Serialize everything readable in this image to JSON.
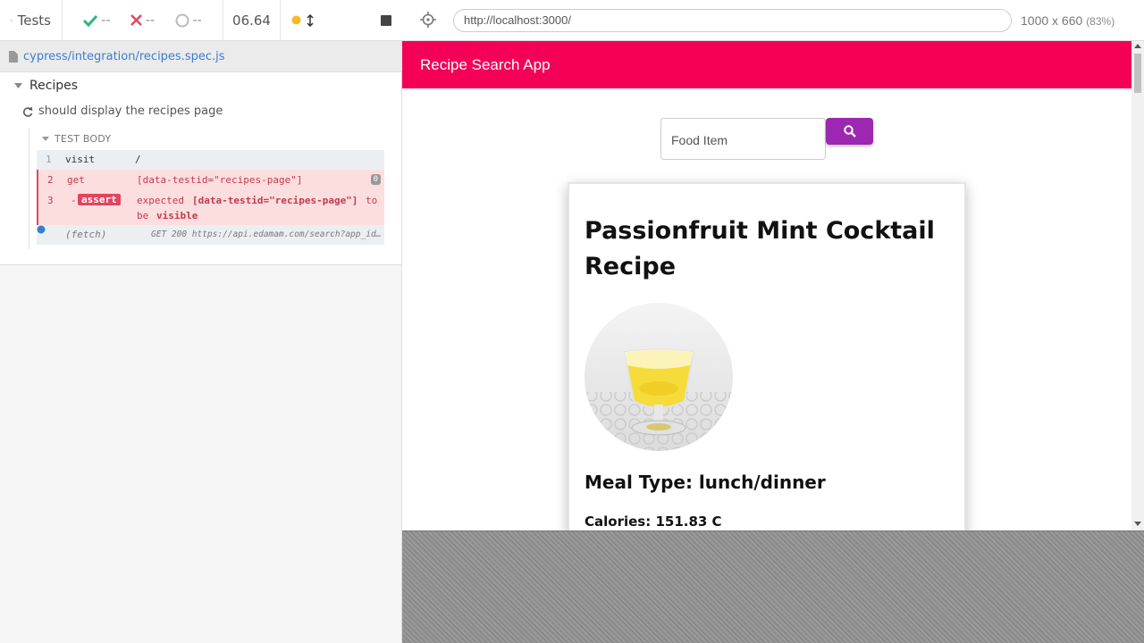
{
  "runner": {
    "tests_label": "Tests",
    "passed": "--",
    "failed": "--",
    "pending": "--",
    "duration": "06.64"
  },
  "spec": {
    "path": "cypress/integration/recipes.spec.js"
  },
  "reporter": {
    "suite": "Recipes",
    "test": "should display the recipes page",
    "body_label": "TEST BODY",
    "commands": [
      {
        "num": "1",
        "name": "visit",
        "message": "/"
      },
      {
        "num": "2",
        "name": "get",
        "message": "[data-testid=\"recipes-page\"]",
        "count": "0"
      },
      {
        "num": "3",
        "prefix": "-",
        "name": "assert",
        "message_parts": [
          "expected",
          "[data-testid=\"recipes-page\"]",
          "to",
          "be",
          "visible"
        ]
      },
      {
        "name": "(fetch)",
        "message": "GET 200 https://api.edamam.com/search?app_id…"
      }
    ]
  },
  "browser": {
    "url": "http://localhost:3000/",
    "viewport": "1000 x 660",
    "zoom": "(83%)"
  },
  "app": {
    "title": "Recipe Search App",
    "search_placeholder": "Food Item",
    "recipe": {
      "title": "Passionfruit Mint Cocktail Recipe",
      "meal_type": "Meal Type: lunch/dinner",
      "calories": "Calories: 151.83 C"
    }
  },
  "colors": {
    "app_bar": "#f50057",
    "search_button": "#9c27b0",
    "error": "#e04660",
    "pass": "#2fb47a",
    "fail": "#e04660",
    "running_dot": "#f5b925"
  },
  "icons": [
    "chevron-left-icon",
    "check-icon",
    "x-icon",
    "spinner-icon",
    "dot-icon",
    "resize-icon",
    "stop-icon",
    "file-icon",
    "triangle-down-icon",
    "refresh-icon",
    "target-icon",
    "search-icon"
  ]
}
